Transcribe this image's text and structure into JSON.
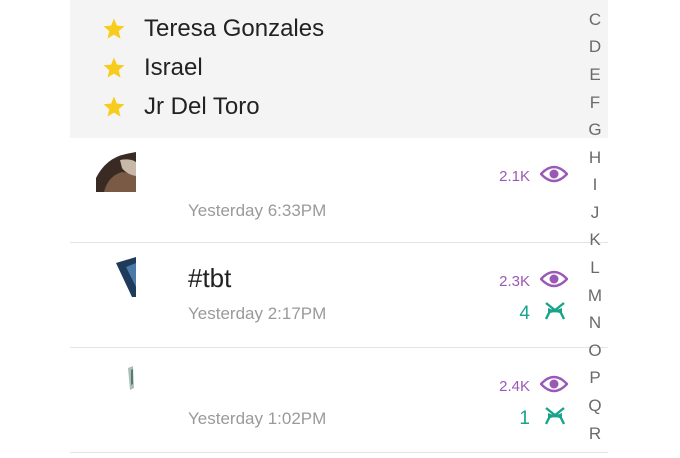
{
  "best_friends": [
    {
      "name": "Teresa Gonzales"
    },
    {
      "name": "Israel"
    },
    {
      "name": "Jr Del Toro"
    }
  ],
  "stories": [
    {
      "title": "",
      "time": "Yesterday 6:33PM",
      "views": "2.1K",
      "screenshots": ""
    },
    {
      "title": "#tbt",
      "time": "Yesterday 2:17PM",
      "views": "2.3K",
      "screenshots": "4"
    },
    {
      "title": "",
      "time": "Yesterday 1:02PM",
      "views": "2.4K",
      "screenshots": "1"
    }
  ],
  "alphabet_index": [
    "C",
    "D",
    "E",
    "F",
    "G",
    "H",
    "I",
    "J",
    "K",
    "L",
    "M",
    "N",
    "O",
    "P",
    "Q",
    "R"
  ],
  "colors": {
    "star": "#f7cc1d",
    "views": "#9b59b6",
    "screenshots": "#19a38a",
    "best_friends_bg": "#f4f4f4"
  },
  "icons": {
    "star": "star-icon",
    "views": "eye-icon",
    "screenshots": "screenshot-arrows-icon"
  }
}
